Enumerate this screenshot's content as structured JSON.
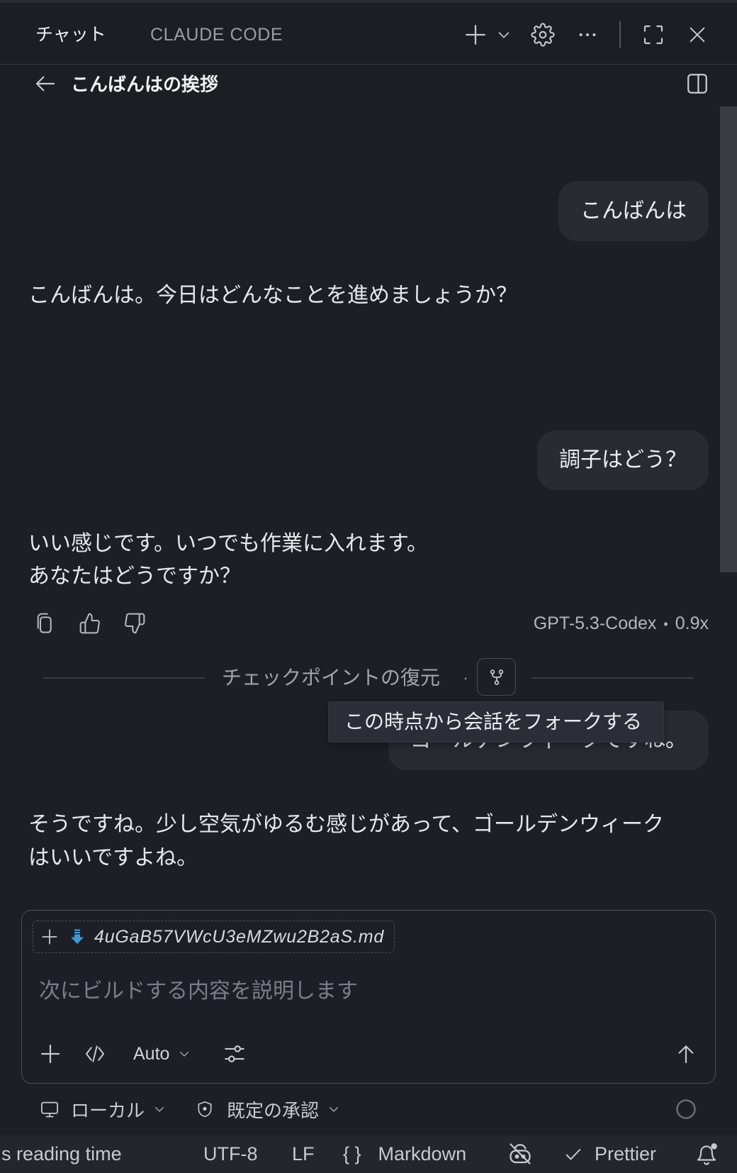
{
  "window": {
    "tabs": [
      {
        "label": "チャット",
        "active": true
      },
      {
        "label": "CLAUDE CODE",
        "active": false
      }
    ],
    "actions": [
      "plus-icon",
      "chevron-down-icon",
      "gear-icon",
      "ellipsis-icon",
      "fullscreen-icon",
      "close-icon"
    ]
  },
  "header": {
    "title": "こんばんはの挨拶",
    "icons": [
      "back-arrow-icon",
      "panel-toggle-icon"
    ]
  },
  "messages": [
    {
      "user_text": "こんばんは"
    },
    {
      "assistant_lines": [
        "こんばんは。今日はどんなことを進めましょうか？"
      ]
    },
    {
      "user_text": "調子はどう？"
    },
    {
      "assistant_lines": [
        "いい感じです。いつでも作業に入れます。",
        "あなたはどうですか？"
      ]
    },
    {
      "user_text": "ゴールデンウィークですね。"
    },
    {
      "assistant_lines": [
        "そうですね。少し空気がゆるむ感じがあって、ゴールデンウィーク",
        "はいいですよね。"
      ]
    }
  ],
  "message_actions": {
    "icons": [
      "copy-icon",
      "thumbs-up-icon",
      "thumbs-down-icon"
    ],
    "model": "GPT-5.3-Codex",
    "separator": "•",
    "multiplier": "0.9x"
  },
  "checkpoint": {
    "label": "チェックポイントの復元",
    "separator": "·",
    "icon": "fork-icon",
    "tooltip": "この時点から会話をフォークする"
  },
  "composer": {
    "attachment": {
      "filename": "4uGaB57VWcU3eMZwu2B2aS.md",
      "icon": "download-arrow-icon"
    },
    "value": "",
    "placeholder": "次にビルドする内容を説明します",
    "mode": "Auto",
    "icons": [
      "plus-icon",
      "code-icon",
      "chevron-down-icon",
      "sliders-icon",
      "arrow-up-icon"
    ]
  },
  "footer": {
    "location": "ローカル",
    "approval": "既定の承認",
    "icons": [
      "monitor-icon",
      "shield-icon",
      "spinner-icon"
    ]
  },
  "status_bar": {
    "reading_time": "s reading time",
    "encoding": "UTF-8",
    "eol": "LF",
    "language_glyph": "{ }",
    "language": "Markdown",
    "formatter": "Prettier",
    "icons": [
      "copilot-off-icon",
      "check-icon",
      "bell-icon"
    ]
  },
  "colors": {
    "background": "#1e1e26",
    "bubble": "#2a2a33",
    "tooltip": "#2d2d38",
    "attachment_icon": "#3d9ad4",
    "status_bar": "#25252d"
  }
}
